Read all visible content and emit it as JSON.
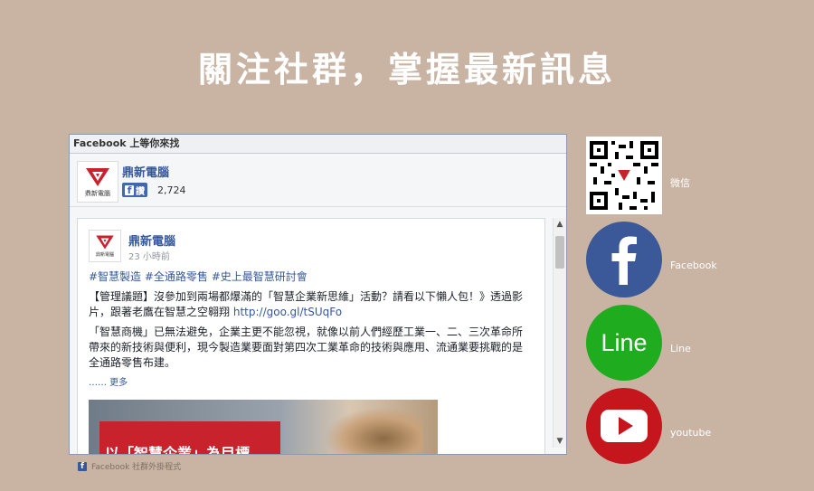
{
  "page": {
    "title": "關注社群，掌握最新訊息"
  },
  "fb_widget": {
    "header": "Facebook 上等你來找",
    "page_name": "鼎新電腦",
    "logo_text": "鼎新電腦",
    "like_label": "讚",
    "like_count": "2,724"
  },
  "post": {
    "author": "鼎新電腦",
    "time": "23 小時前",
    "hashtags": "#智慧製造 #全通路零售 #史上最智慧研討會",
    "para1": "【管理議題】沒參加到兩場都爆滿的「智慧企業新思維」活動？請看以下懶人包！》透過影片，跟著老鷹在智慧之空翱翔",
    "link": "http://goo.gl/tSUqFo",
    "para2": "「智慧商機」已無法避免，企業主更不能忽視，就像以前人們經歷工業一、二、三次革命所帶來的新技術與便利，現今製造業要面對第四次工業革命的技術與應用、流通業要挑戰的是全通路零售布建。",
    "more": "…… 更多",
    "image_banner": "以「智慧企業」為目標，"
  },
  "plugin_note": "Facebook 社群外掛程式",
  "social": {
    "wechat_label": "微信",
    "facebook_label": "Facebook",
    "line_label": "Line",
    "line_logo": "Line",
    "youtube_label": "youtube"
  },
  "colors": {
    "background": "#c9b4a4",
    "facebook": "#3b5998",
    "line": "#1fac1f",
    "youtube": "#c4161c"
  }
}
